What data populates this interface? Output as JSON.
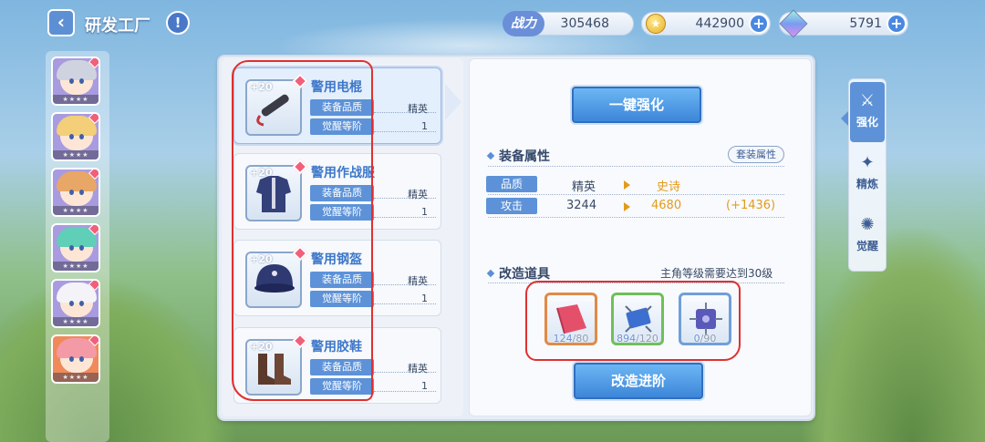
{
  "header": {
    "title": "研发工厂",
    "back_icon": "chevron-left-icon",
    "info_label": "!",
    "power_label": "战力",
    "power_value": "305468",
    "coins_value": "442900",
    "gems_value": "5791",
    "plus_label": "+"
  },
  "characters": [
    {
      "stars": "★★★★",
      "hair": "#cfd3e0"
    },
    {
      "stars": "★★★★",
      "hair": "#f2cf78"
    },
    {
      "stars": "★★★★",
      "hair": "#e8a766"
    },
    {
      "stars": "★★★★",
      "hair": "#5fcfb7"
    },
    {
      "stars": "★★★★",
      "hair": "#f4f4f8"
    },
    {
      "stars": "★★★★",
      "hair": "#f39aa6"
    }
  ],
  "equipment": [
    {
      "level": "+20",
      "name": "警用电棍",
      "tag1": "装备品质",
      "tag2": "觉醒等阶",
      "quality": "精英",
      "stage": "1",
      "icon": "baton-icon"
    },
    {
      "level": "+20",
      "name": "警用作战服",
      "tag1": "装备品质",
      "tag2": "觉醒等阶",
      "quality": "精英",
      "stage": "1",
      "icon": "uniform-icon"
    },
    {
      "level": "+20",
      "name": "警用钢盔",
      "tag1": "装备品质",
      "tag2": "觉醒等阶",
      "quality": "精英",
      "stage": "1",
      "icon": "helmet-icon"
    },
    {
      "level": "+20",
      "name": "警用胶鞋",
      "tag1": "装备品质",
      "tag2": "觉醒等阶",
      "quality": "精英",
      "stage": "1",
      "icon": "boots-icon"
    }
  ],
  "detail": {
    "enhance_button": "一键强化",
    "attributes_title": "装备属性",
    "set_button": "套装属性",
    "quality_label": "品质",
    "quality_current": "精英",
    "quality_next": "史诗",
    "attack_label": "攻击",
    "attack_current": "3244",
    "attack_next": "4680",
    "attack_delta": "(+1436)",
    "materials_title": "改造道具",
    "requirement": "主角等级需要达到30级",
    "materials": [
      {
        "have": "124",
        "need": "/80",
        "icon": "fabric-icon"
      },
      {
        "have": "894",
        "need": "/120",
        "icon": "chip-icon"
      },
      {
        "have": "0",
        "need": "/90",
        "icon": "module-icon"
      }
    ],
    "upgrade_button": "改造进阶"
  },
  "side_tabs": [
    {
      "label": "强化",
      "glyph": "⚔",
      "icon": "sword-icon"
    },
    {
      "label": "精炼",
      "glyph": "✦",
      "icon": "refine-icon"
    },
    {
      "label": "觉醒",
      "glyph": "✺",
      "icon": "awaken-icon"
    }
  ],
  "colors": {
    "accent": "#5d92d8",
    "gold": "#e39b1e",
    "annotation": "#e03030"
  }
}
